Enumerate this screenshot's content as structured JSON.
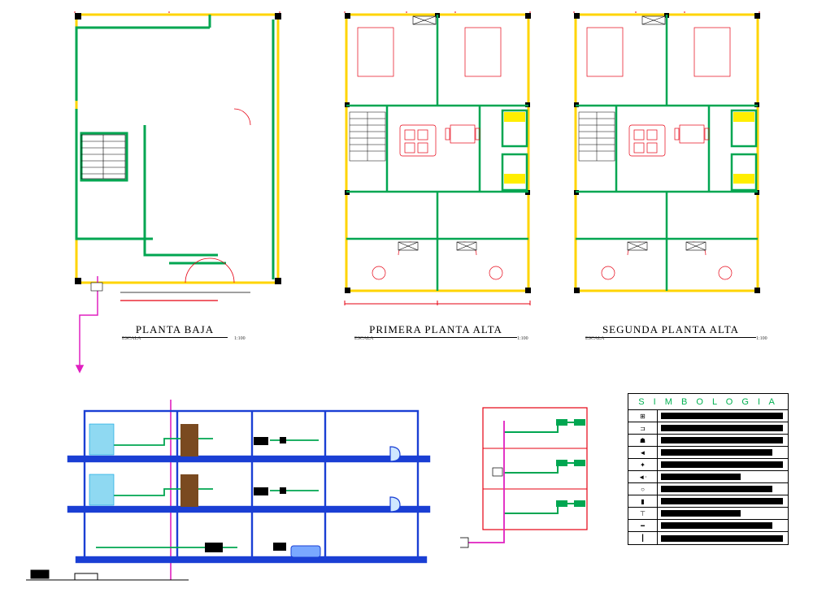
{
  "plans": {
    "ground": {
      "title": "PLANTA BAJA",
      "scale_prefix": "ESCALA",
      "scale": "1:100"
    },
    "first": {
      "title": "PRIMERA PLANTA ALTA",
      "scale_prefix": "ESCALA",
      "scale": "1:100"
    },
    "second": {
      "title": "SEGUNDA PLANTA ALTA",
      "scale_prefix": "ESCALA",
      "scale": "1:100"
    }
  },
  "legend": {
    "title": "S I M B O L O G I A",
    "items": [
      {
        "symbol_glyph": "⊞",
        "desc_width": "full"
      },
      {
        "symbol_glyph": "⊐",
        "desc_width": "full"
      },
      {
        "symbol_glyph": "☗",
        "desc_width": "full"
      },
      {
        "symbol_glyph": "◄",
        "desc_width": "med"
      },
      {
        "symbol_glyph": "✦",
        "desc_width": "full"
      },
      {
        "symbol_glyph": "◄·",
        "desc_width": "short"
      },
      {
        "symbol_glyph": "○",
        "desc_width": "med"
      },
      {
        "symbol_glyph": "▮",
        "desc_width": "full"
      },
      {
        "symbol_glyph": "⊤",
        "desc_width": "short"
      },
      {
        "symbol_glyph": "━",
        "desc_width": "med"
      },
      {
        "symbol_glyph": "┃",
        "desc_width": "full"
      }
    ]
  },
  "colors": {
    "wall_outer": "#ffd400",
    "wall_inner": "#00a651",
    "dim_line": "#e60012",
    "section_blue": "#1a3fd4",
    "riser_magenta": "#e020c0",
    "fixture_cyan": "#00a0e0",
    "highlight_yellow": "#ffee00"
  }
}
